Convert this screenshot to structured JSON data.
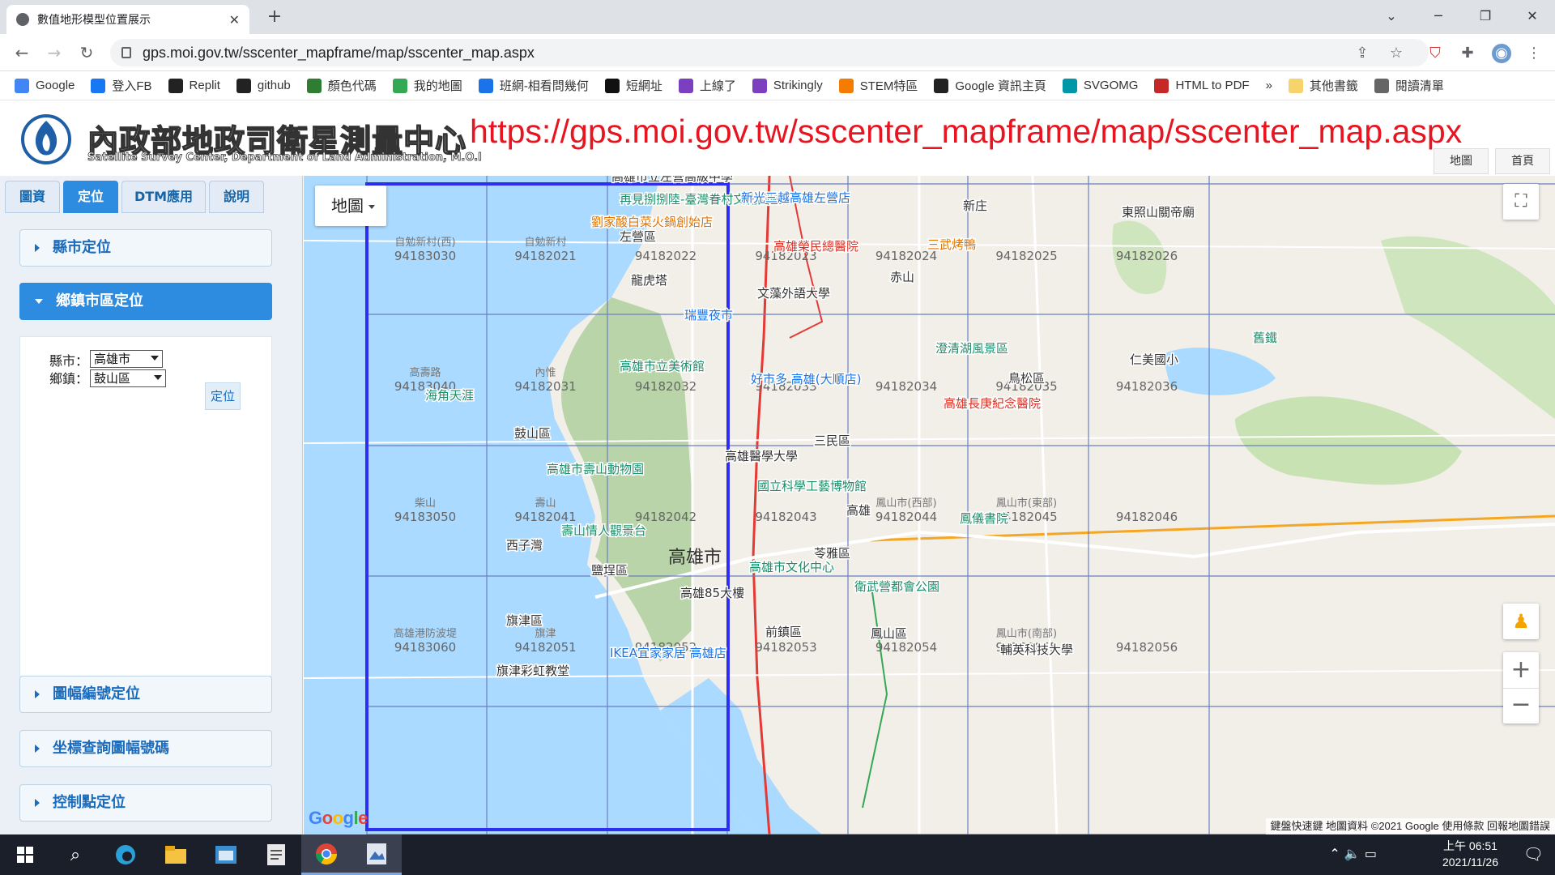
{
  "browser": {
    "tab_title": "數值地形模型位置展示",
    "url": "gps.moi.gov.tw/sscenter_mapframe/map/sscenter_map.aspx",
    "bookmarks": [
      {
        "label": "Google",
        "icon": "google-icon",
        "color": "#4285f4"
      },
      {
        "label": "登入FB",
        "icon": "facebook-icon",
        "color": "#1877f2"
      },
      {
        "label": "Replit",
        "icon": "replit-icon",
        "color": "#222222"
      },
      {
        "label": "github",
        "icon": "github-icon",
        "color": "#222222"
      },
      {
        "label": "顏色代碼",
        "icon": "color-icon",
        "color": "#2e7d32"
      },
      {
        "label": "我的地圖",
        "icon": "map-icon",
        "color": "#34a853"
      },
      {
        "label": "班網-相看問幾何",
        "icon": "globe-icon",
        "color": "#1a73e8"
      },
      {
        "label": "短網址",
        "icon": "shortlink-icon",
        "color": "#111111"
      },
      {
        "label": "上線了",
        "icon": "strikingly-icon",
        "color": "#7b3fbf"
      },
      {
        "label": "Strikingly",
        "icon": "strikingly-icon",
        "color": "#7b3fbf"
      },
      {
        "label": "STEM特區",
        "icon": "blogger-icon",
        "color": "#f57c00"
      },
      {
        "label": "Google 資訊主頁",
        "icon": "p-icon",
        "color": "#222222"
      },
      {
        "label": "SVGOMG",
        "icon": "svgomg-icon",
        "color": "#0097a7"
      },
      {
        "label": "HTML to PDF",
        "icon": "ltn-icon",
        "color": "#c62828"
      }
    ],
    "bookmarks_overflow": "»",
    "other_bookmarks": "其他書籤",
    "reading_list": "閱讀清單"
  },
  "header": {
    "title": "內政部地政司衛星測量中心",
    "subtitle": "Satellite Survey Center, Department of Land Administration, M.O.I",
    "overlay_url": "https://gps.moi.gov.tw/sscenter_mapframe/map/sscenter_map.aspx",
    "btn_map": "地圖",
    "btn_home": "首頁"
  },
  "sidebar": {
    "tabs": [
      "圖資",
      "定位",
      "DTM應用",
      "說明"
    ],
    "active_tab": "定位",
    "sections": {
      "county": "縣市定位",
      "township": "鄉鎮市區定位",
      "sheet": "圖幅編號定位",
      "coord": "坐標查詢圖幅號碼",
      "control": "控制點定位"
    },
    "form": {
      "county_label": "縣市：",
      "county_value": "高雄市",
      "town_label": "鄉鎮：",
      "town_value": "鼓山區",
      "locate_btn": "定位"
    }
  },
  "map": {
    "type_selector": "地圖",
    "google": "Google",
    "attribution": "鍵盤快速鍵   地圖資料 ©2021 Google   使用條款   回報地圖錯誤",
    "center_label": "高雄市",
    "sheets": [
      {
        "place": "自勉新村(西)",
        "code": "94183030"
      },
      {
        "place": "自勉新村",
        "code": "94182021"
      },
      {
        "place": "",
        "code": "94182022"
      },
      {
        "place": "",
        "code": "94182023"
      },
      {
        "place": "",
        "code": "94182024"
      },
      {
        "place": "",
        "code": "94182025"
      },
      {
        "place": "",
        "code": "94182026"
      },
      {
        "place": "高壽路",
        "code": "94183040"
      },
      {
        "place": "內惟",
        "code": "94182031"
      },
      {
        "place": "",
        "code": "94182032"
      },
      {
        "place": "",
        "code": "94182033"
      },
      {
        "place": "",
        "code": "94182034"
      },
      {
        "place": "",
        "code": "94182035"
      },
      {
        "place": "",
        "code": "94182036"
      },
      {
        "place": "柴山",
        "code": "94183050"
      },
      {
        "place": "壽山",
        "code": "94182041"
      },
      {
        "place": "",
        "code": "94182042"
      },
      {
        "place": "",
        "code": "94182043"
      },
      {
        "place": "鳳山市(西部)",
        "code": "94182044"
      },
      {
        "place": "鳳山市(東部)",
        "code": "94182045"
      },
      {
        "place": "",
        "code": "94182046"
      },
      {
        "place": "高雄港防波堤",
        "code": "94183060"
      },
      {
        "place": "旗津",
        "code": "94182051"
      },
      {
        "place": "",
        "code": "94182052"
      },
      {
        "place": "",
        "code": "94182053"
      },
      {
        "place": "",
        "code": "94182054"
      },
      {
        "place": "鳳山市(南部)",
        "code": "94182055"
      },
      {
        "place": "",
        "code": "94182056"
      }
    ],
    "pois": [
      {
        "text": "再見捌捌陸-臺灣眷村文化園區",
        "color": "#1e8e6a"
      },
      {
        "text": "劉家酸白菜火鍋創始店",
        "color": "#e37400"
      },
      {
        "text": "新光三越高雄左營店",
        "color": "#1a73e8"
      },
      {
        "text": "高雄榮民總醫院",
        "color": "#d93025"
      },
      {
        "text": "三武烤鴨",
        "color": "#e37400"
      },
      {
        "text": "左營區",
        "color": "#333333"
      },
      {
        "text": "龍虎塔",
        "color": "#333333"
      },
      {
        "text": "文藻外語大學",
        "color": "#333333"
      },
      {
        "text": "瑞豐夜市",
        "color": "#1a73e8"
      },
      {
        "text": "澄清湖風景區",
        "color": "#1e8e6a"
      },
      {
        "text": "高雄市立美術館",
        "color": "#1e8e6a"
      },
      {
        "text": "好市多 高雄(大順店)",
        "color": "#1a73e8"
      },
      {
        "text": "高雄長庚紀念醫院",
        "color": "#d93025"
      },
      {
        "text": "仁美國小",
        "color": "#333333"
      },
      {
        "text": "海角天涯",
        "color": "#1e8e6a"
      },
      {
        "text": "鼓山區",
        "color": "#333333"
      },
      {
        "text": "高雄醫學大學",
        "color": "#333333"
      },
      {
        "text": "高雄市壽山動物園",
        "color": "#1e8e6a"
      },
      {
        "text": "國立科學工藝博物館",
        "color": "#1e8e6a"
      },
      {
        "text": "高雄",
        "color": "#333333"
      },
      {
        "text": "鳳儀書院",
        "color": "#1e8e6a"
      },
      {
        "text": "壽山情人觀景台",
        "color": "#1e8e6a"
      },
      {
        "text": "西子灣",
        "color": "#333333"
      },
      {
        "text": "鹽埕區",
        "color": "#333333"
      },
      {
        "text": "苓雅區",
        "color": "#333333"
      },
      {
        "text": "高雄市文化中心",
        "color": "#1e8e6a"
      },
      {
        "text": "高雄85大樓",
        "color": "#333333"
      },
      {
        "text": "衛武營都會公園",
        "color": "#1e8e6a"
      },
      {
        "text": "旗津區",
        "color": "#333333"
      },
      {
        "text": "前鎮區",
        "color": "#333333"
      },
      {
        "text": "鳳山區",
        "color": "#333333"
      },
      {
        "text": "IKEA宜家家居 高雄店",
        "color": "#1a73e8"
      },
      {
        "text": "輔英科技大學",
        "color": "#333333"
      },
      {
        "text": "旗津彩虹教堂",
        "color": "#333333"
      },
      {
        "text": "東照山關帝廟",
        "color": "#333333"
      },
      {
        "text": "新庄",
        "color": "#333333"
      },
      {
        "text": "赤山",
        "color": "#333333"
      },
      {
        "text": "鳥松區",
        "color": "#333333"
      },
      {
        "text": "三民區",
        "color": "#333333"
      },
      {
        "text": "舊鐵",
        "color": "#1e8e6a"
      },
      {
        "text": "高雄市立左營高級中學",
        "color": "#333333"
      }
    ]
  },
  "taskbar": {
    "time": "上午 06:51",
    "date": "2021/11/26"
  }
}
